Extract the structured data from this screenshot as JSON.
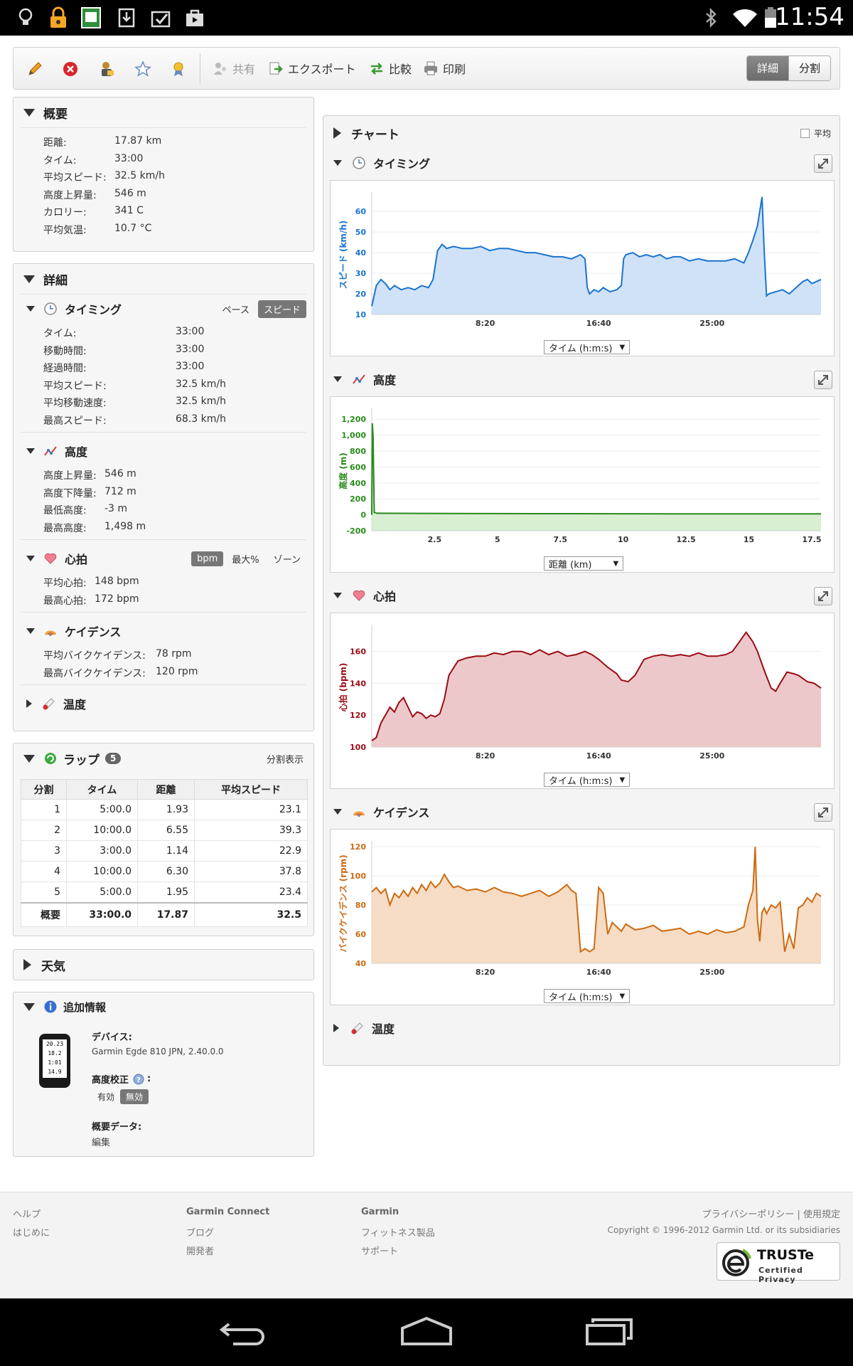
{
  "status_bar": {
    "time": "11:54"
  },
  "toolbar": {
    "share": "共有",
    "export": "エクスポート",
    "compare": "比較",
    "print": "印刷",
    "view_detail": "詳細",
    "view_split": "分割"
  },
  "summary": {
    "title": "概要",
    "rows": [
      {
        "label": "距離:",
        "value": "17.87 km"
      },
      {
        "label": "タイム:",
        "value": "33:00"
      },
      {
        "label": "平均スピード:",
        "value": "32.5 km/h"
      },
      {
        "label": "高度上昇量:",
        "value": "546 m"
      },
      {
        "label": "カロリー:",
        "value": "341 C"
      },
      {
        "label": "平均気温:",
        "value": "10.7 °C"
      }
    ]
  },
  "details": {
    "title": "詳細",
    "timing": {
      "title": "タイミング",
      "toggle_pace": "ペース",
      "toggle_speed": "スピード",
      "rows": [
        {
          "label": "タイム:",
          "value": "33:00"
        },
        {
          "label": "移動時間:",
          "value": "33:00"
        },
        {
          "label": "経過時間:",
          "value": "33:00"
        },
        {
          "label": "平均スピード:",
          "value": "32.5 km/h"
        },
        {
          "label": "平均移動速度:",
          "value": "32.5 km/h"
        },
        {
          "label": "最高スピード:",
          "value": "68.3 km/h"
        }
      ]
    },
    "elevation": {
      "title": "高度",
      "rows": [
        {
          "label": "高度上昇量:",
          "value": "546 m"
        },
        {
          "label": "高度下降量:",
          "value": "712 m"
        },
        {
          "label": "最低高度:",
          "value": "-3 m"
        },
        {
          "label": "最高高度:",
          "value": "1,498 m"
        }
      ]
    },
    "heart_rate": {
      "title": "心拍",
      "toggle_bpm": "bpm",
      "toggle_max": "最大%",
      "toggle_zone": "ゾーン",
      "rows": [
        {
          "label": "平均心拍:",
          "value": "148 bpm"
        },
        {
          "label": "最高心拍:",
          "value": "172 bpm"
        }
      ]
    },
    "cadence": {
      "title": "ケイデンス",
      "rows": [
        {
          "label": "平均バイクケイデンス:",
          "value": "78 rpm"
        },
        {
          "label": "最高バイクケイデンス:",
          "value": "120 rpm"
        }
      ]
    },
    "temperature": {
      "title": "温度"
    }
  },
  "laps": {
    "title": "ラップ",
    "count": "5",
    "split_view": "分割表示",
    "headers": [
      "分割",
      "タイム",
      "距離",
      "平均スピード"
    ],
    "rows": [
      [
        "1",
        "5:00.0",
        "1.93",
        "23.1"
      ],
      [
        "2",
        "10:00.0",
        "6.55",
        "39.3"
      ],
      [
        "3",
        "3:00.0",
        "1.14",
        "22.9"
      ],
      [
        "4",
        "10:00.0",
        "6.30",
        "37.8"
      ],
      [
        "5",
        "5:00.0",
        "1.95",
        "23.4"
      ]
    ],
    "total": [
      "概要",
      "33:00.0",
      "17.87",
      "32.5"
    ]
  },
  "weather": {
    "title": "天気"
  },
  "extra": {
    "title": "追加情報",
    "device_label": "デバイス:",
    "device_value": "Garmin Egde 810 JPN, 2.40.0.0",
    "elev_corr_label": "高度校正",
    "elev_corr_suffix": ":",
    "enabled": "有効",
    "disabled": "無効",
    "summary_data_label": "概要データ:",
    "edit": "編集",
    "device_screen": [
      "20.23",
      "18.2",
      "1:01",
      "14.9"
    ]
  },
  "charts": {
    "title": "チャート",
    "average_label": "平均",
    "timing_title": "タイミング",
    "elevation_title": "高度",
    "heart_title": "心拍",
    "cadence_title": "ケイデンス",
    "temperature_title": "温度",
    "time_dropdown": "タイム (h:m:s)",
    "distance_dropdown": "距離 (km)"
  },
  "chart_data": [
    {
      "type": "area",
      "ylabel": "スピード (km/h)",
      "color": "#1a73d0",
      "fill": "#cfe2f7",
      "ylim": [
        10,
        68
      ],
      "yticks": [
        10,
        20,
        30,
        40,
        50,
        60
      ],
      "xlim": [
        0,
        1980
      ],
      "xticks": [
        {
          "v": 500,
          "label": "8:20"
        },
        {
          "v": 1000,
          "label": "16:40"
        },
        {
          "v": 1500,
          "label": "25:00"
        }
      ],
      "x": [
        0,
        20,
        40,
        60,
        80,
        100,
        130,
        160,
        190,
        220,
        250,
        270,
        290,
        310,
        330,
        360,
        400,
        440,
        480,
        520,
        560,
        600,
        640,
        680,
        720,
        760,
        800,
        840,
        880,
        920,
        940,
        950,
        960,
        980,
        1000,
        1020,
        1050,
        1080,
        1100,
        1110,
        1120,
        1150,
        1180,
        1210,
        1240,
        1270,
        1300,
        1330,
        1360,
        1400,
        1440,
        1480,
        1520,
        1560,
        1600,
        1640,
        1660,
        1680,
        1700,
        1720,
        1730,
        1740,
        1750,
        1780,
        1810,
        1840,
        1860,
        1880,
        1900,
        1920,
        1940,
        1960,
        1980
      ],
      "y": [
        14,
        24,
        27,
        25,
        22,
        24,
        22,
        23,
        22,
        24,
        23,
        27,
        41,
        44,
        42,
        43,
        42,
        42,
        43,
        41,
        42,
        42,
        41,
        40,
        40,
        39,
        38,
        38,
        37,
        39,
        37,
        23,
        20,
        22,
        21,
        23,
        21,
        22,
        24,
        37,
        39,
        40,
        38,
        39,
        38,
        39,
        37,
        38,
        38,
        36,
        37,
        36,
        36,
        36,
        37,
        35,
        40,
        46,
        53,
        67,
        40,
        19,
        20,
        21,
        22,
        20,
        22,
        24,
        26,
        27,
        25,
        26,
        27
      ]
    },
    {
      "type": "area",
      "ylabel": "高度 (m)",
      "color": "#2a8a1c",
      "fill": "#d8efd2",
      "ylim": [
        -200,
        1300
      ],
      "yticks": [
        -200,
        0,
        200,
        400,
        600,
        800,
        1000,
        1200
      ],
      "yticklabels": [
        "-200",
        "0",
        "200",
        "400",
        "600",
        "800",
        "1,000",
        "1,200"
      ],
      "xlim": [
        0,
        17.87
      ],
      "xticks": [
        {
          "v": 2.5,
          "label": "2.5"
        },
        {
          "v": 5,
          "label": "5"
        },
        {
          "v": 7.5,
          "label": "7.5"
        },
        {
          "v": 10,
          "label": "10"
        },
        {
          "v": 12.5,
          "label": "12.5"
        },
        {
          "v": 15,
          "label": "15"
        },
        {
          "v": 17.5,
          "label": "17.5"
        }
      ],
      "x": [
        0,
        0.02,
        0.05,
        0.1,
        0.2,
        2,
        5,
        8,
        10,
        12,
        15,
        17.87
      ],
      "y": [
        0,
        1150,
        1000,
        30,
        20,
        18,
        15,
        14,
        13,
        12,
        12,
        12
      ]
    },
    {
      "type": "area",
      "ylabel": "心拍 (bpm)",
      "color": "#990c14",
      "fill": "#edc8cb",
      "ylim": [
        100,
        175
      ],
      "yticks": [
        100,
        120,
        140,
        160
      ],
      "xlim": [
        0,
        1980
      ],
      "xticks": [
        {
          "v": 500,
          "label": "8:20"
        },
        {
          "v": 1000,
          "label": "16:40"
        },
        {
          "v": 1500,
          "label": "25:00"
        }
      ],
      "x": [
        0,
        20,
        40,
        60,
        80,
        100,
        120,
        140,
        160,
        180,
        200,
        220,
        240,
        260,
        280,
        300,
        320,
        340,
        380,
        420,
        460,
        500,
        540,
        580,
        620,
        660,
        700,
        740,
        780,
        820,
        860,
        900,
        940,
        970,
        1000,
        1040,
        1080,
        1100,
        1130,
        1160,
        1200,
        1240,
        1280,
        1320,
        1360,
        1400,
        1440,
        1480,
        1520,
        1560,
        1590,
        1620,
        1650,
        1680,
        1700,
        1730,
        1760,
        1780,
        1800,
        1830,
        1860,
        1880,
        1900,
        1920,
        1950,
        1980
      ],
      "y": [
        104,
        106,
        115,
        120,
        125,
        122,
        128,
        131,
        125,
        119,
        122,
        121,
        118,
        120,
        119,
        121,
        130,
        145,
        154,
        156,
        157,
        157,
        159,
        158,
        160,
        160,
        158,
        161,
        158,
        160,
        157,
        158,
        160,
        158,
        155,
        150,
        146,
        142,
        141,
        145,
        155,
        157,
        158,
        157,
        158,
        157,
        159,
        157,
        157,
        158,
        160,
        166,
        172,
        166,
        160,
        148,
        137,
        135,
        140,
        147,
        146,
        145,
        143,
        141,
        140,
        137
      ]
    },
    {
      "type": "area",
      "ylabel": "バイクケイデンス (rpm)",
      "color": "#cc6a10",
      "fill": "#f6dcc4",
      "ylim": [
        40,
        122
      ],
      "yticks": [
        40,
        60,
        80,
        100,
        120
      ],
      "xlim": [
        0,
        1980
      ],
      "xticks": [
        {
          "v": 500,
          "label": "8:20"
        },
        {
          "v": 1000,
          "label": "16:40"
        },
        {
          "v": 1500,
          "label": "25:00"
        }
      ],
      "x": [
        0,
        20,
        40,
        60,
        80,
        100,
        120,
        140,
        160,
        180,
        200,
        220,
        240,
        260,
        280,
        300,
        320,
        340,
        360,
        380,
        420,
        460,
        500,
        540,
        580,
        620,
        660,
        700,
        740,
        780,
        820,
        860,
        880,
        900,
        920,
        940,
        960,
        980,
        1000,
        1020,
        1040,
        1060,
        1080,
        1100,
        1120,
        1160,
        1200,
        1240,
        1280,
        1320,
        1360,
        1400,
        1440,
        1480,
        1520,
        1560,
        1600,
        1640,
        1660,
        1680,
        1690,
        1700,
        1710,
        1720,
        1730,
        1740,
        1760,
        1780,
        1800,
        1820,
        1840,
        1860,
        1880,
        1900,
        1920,
        1940,
        1960,
        1980
      ],
      "y": [
        89,
        92,
        88,
        91,
        80,
        88,
        85,
        90,
        86,
        92,
        88,
        94,
        90,
        96,
        92,
        95,
        101,
        96,
        92,
        93,
        90,
        91,
        89,
        92,
        89,
        88,
        86,
        88,
        90,
        86,
        89,
        94,
        90,
        88,
        48,
        50,
        48,
        50,
        92,
        88,
        60,
        68,
        65,
        62,
        67,
        63,
        64,
        66,
        62,
        63,
        64,
        60,
        62,
        60,
        63,
        61,
        62,
        65,
        80,
        90,
        120,
        70,
        55,
        75,
        78,
        74,
        80,
        78,
        82,
        48,
        60,
        50,
        78,
        80,
        85,
        82,
        88,
        86
      ]
    }
  ],
  "footer": {
    "help": "ヘルプ",
    "getting_started": "はじめに",
    "garmin_connect": "Garmin Connect",
    "blog": "ブログ",
    "developers": "開発者",
    "garmin": "Garmin",
    "fitness_products": "フィットネス製品",
    "support": "サポート",
    "privacy": "プライバシーポリシー",
    "sep": "|",
    "terms": "使用規定",
    "copyright": "Copyright © 1996-2012 Garmin Ltd. or its subsidiaries",
    "truste_main": "TRUSTe",
    "truste_sub": "Certified Privacy"
  }
}
